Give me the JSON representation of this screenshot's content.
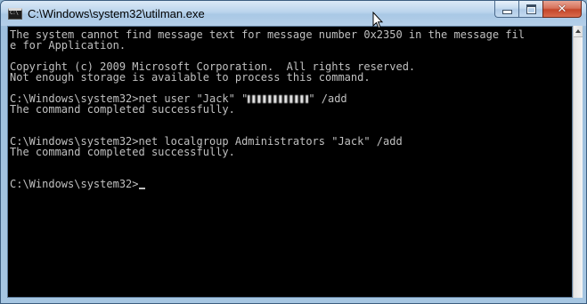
{
  "window": {
    "title": "C:\\Windows\\system32\\utilman.exe",
    "app_icon_text": "C:\\"
  },
  "caption_buttons": {
    "minimize_icon": "minimize-icon",
    "maximize_icon": "maximize-icon",
    "close_icon": "close-icon",
    "close_glyph": "✕"
  },
  "console": {
    "background_color": "#000000",
    "text_color": "#c0c0c0",
    "lines": [
      "The system cannot find message text for message number 0x2350 in the message fil",
      "e for Application.",
      "",
      "Copyright (c) 2009 Microsoft Corporation.  All rights reserved.",
      "Not enough storage is available to process this command.",
      "",
      {
        "before": "C:\\Windows\\system32>net user \"Jack\" \"",
        "after": "\" /add"
      },
      "The command completed successfully.",
      "",
      "",
      "C:\\Windows\\system32>net localgroup Administrators \"Jack\" /add",
      "The command completed successfully.",
      "",
      "",
      {
        "prompt": "C:\\Windows\\system32>"
      }
    ]
  }
}
